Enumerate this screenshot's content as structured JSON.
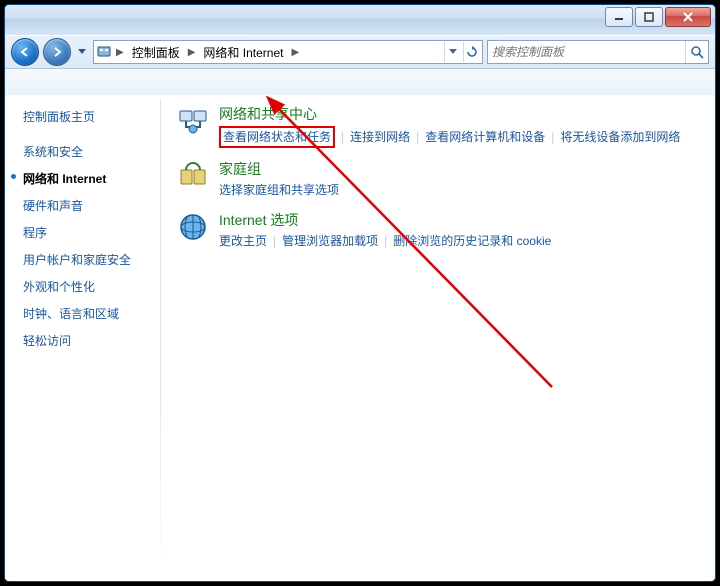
{
  "breadcrumb": {
    "root_icon": "control-panel",
    "crumb1": "控制面板",
    "crumb2": "网络和 Internet"
  },
  "search": {
    "placeholder": "搜索控制面板"
  },
  "sidebar": {
    "items": [
      {
        "label": "控制面板主页",
        "active": false,
        "heading": true
      },
      {
        "label": "系统和安全",
        "active": false
      },
      {
        "label": "网络和 Internet",
        "active": true
      },
      {
        "label": "硬件和声音",
        "active": false
      },
      {
        "label": "程序",
        "active": false
      },
      {
        "label": "用户帐户和家庭安全",
        "active": false
      },
      {
        "label": "外观和个性化",
        "active": false
      },
      {
        "label": "时钟、语言和区域",
        "active": false
      },
      {
        "label": "轻松访问",
        "active": false
      }
    ]
  },
  "categories": [
    {
      "title": "网络和共享中心",
      "links": [
        "查看网络状态和任务",
        "连接到网络",
        "查看网络计算机和设备",
        "将无线设备添加到网络"
      ],
      "highlight_index": 0
    },
    {
      "title": "家庭组",
      "links": [
        "选择家庭组和共享选项"
      ]
    },
    {
      "title": "Internet 选项",
      "links": [
        "更改主页",
        "管理浏览器加载项",
        "删除浏览的历史记录和 cookie"
      ]
    }
  ]
}
